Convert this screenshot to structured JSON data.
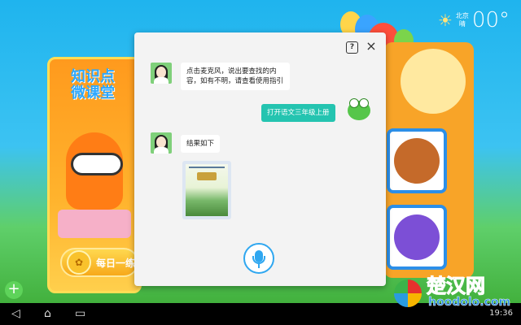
{
  "weather": {
    "city": "北京",
    "condition": "晴",
    "temperature": "00°",
    "icon": "sun-icon"
  },
  "background": {
    "left_card_title": "知识点\n微课堂",
    "daily_button_label": "每日一练"
  },
  "dialog": {
    "help_icon": "?",
    "close_icon": "×",
    "messages": [
      {
        "from": "assistant",
        "text": "点击麦克风，说出要查找的内容，如有不明，请查看使用指引"
      },
      {
        "from": "user",
        "text": "打开语文三年级上册"
      },
      {
        "from": "assistant",
        "text": "结果如下"
      }
    ],
    "result_book": "textbook-cover",
    "mic_icon": "microphone-icon"
  },
  "navbar": {
    "time": "19:36"
  },
  "watermark": {
    "name": "楚汉网",
    "url": "hoodolo.com"
  }
}
